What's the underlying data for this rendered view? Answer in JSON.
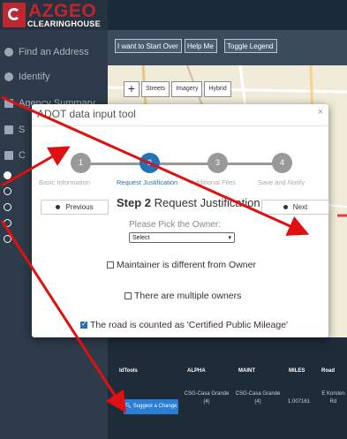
{
  "logo": {
    "brand": "AZGEO",
    "sub": "CLEARINGHOUSE"
  },
  "sidebar": {
    "items": [
      {
        "label": "Find an Address",
        "icon": "map-pin-icon"
      },
      {
        "label": "Identify",
        "icon": "info-icon"
      },
      {
        "label": "Agency Summary",
        "icon": "report-icon"
      },
      {
        "label": "S",
        "icon": "copy-icon"
      },
      {
        "label": "C",
        "icon": "box-icon"
      }
    ]
  },
  "toolbar": {
    "start_over": "I want to Start Over",
    "help": "Help Me",
    "legend": "Toggle Legend"
  },
  "map": {
    "zoom_in": "+",
    "tabs": [
      "Streets",
      "Imagery",
      "Hybrid"
    ]
  },
  "modal": {
    "title": "ADOT data input tool",
    "close": "×",
    "steps": [
      {
        "num": "1",
        "label": "Basic Information"
      },
      {
        "num": "2",
        "label": "Request Justification"
      },
      {
        "num": "3",
        "label": "Additional Files"
      },
      {
        "num": "4",
        "label": "Save and Notify"
      }
    ],
    "prev": "Previous",
    "next": "Next",
    "step_title_bold": "Step 2",
    "step_title_rest": " Request Justification",
    "pick_label": "Please Pick the Owner:",
    "select_value": "Select",
    "maintainer": "Maintainer is different from Owner",
    "multiple": "There are multiple owners",
    "certified": "The road is counted as 'Certified Public Mileage'"
  },
  "table": {
    "headers": [
      "IdTools",
      "ALPHA",
      "MAINT",
      "MILES",
      "Road"
    ],
    "row": {
      "id": "0",
      "suggest": "Suggest a Change",
      "alpha": "CSG-Casa Grande (4)",
      "maint": "CSG-Casa Grande (4)",
      "miles": "1.007161",
      "road": "E Korsten Rd"
    }
  }
}
